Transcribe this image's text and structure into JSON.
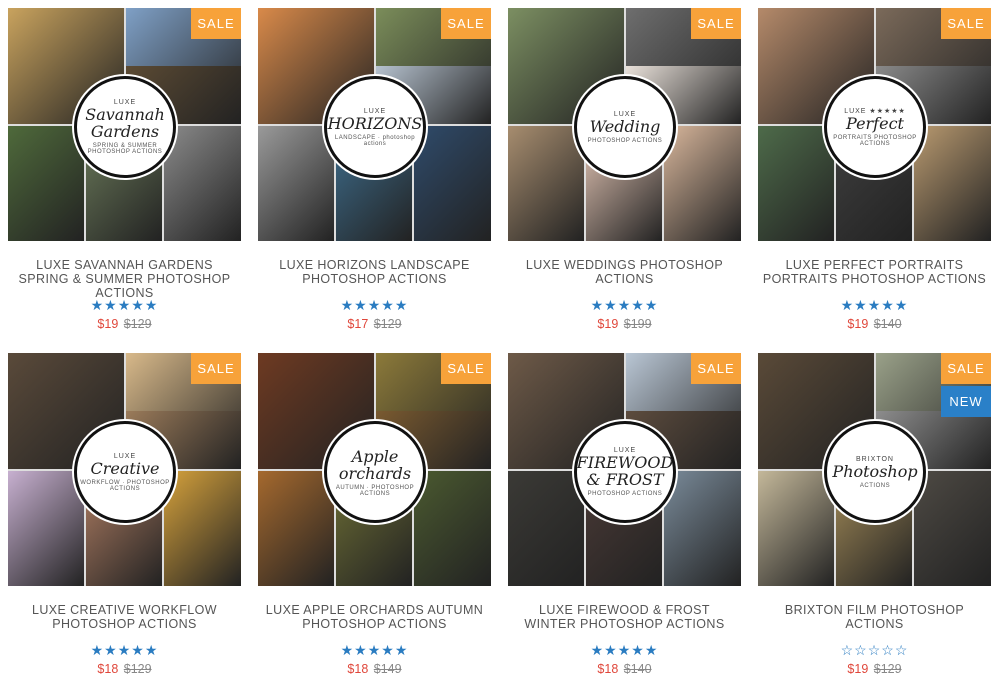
{
  "colors": {
    "sale_badge": "#f7a23a",
    "new_badge": "#2a80c8",
    "star": "#2a7cc1",
    "price_now": "#e0473b",
    "price_was": "#888888"
  },
  "products": [
    {
      "title": "LUXE SAVANNAH GARDENS SPRING & SUMMER PHOTOSHOP ACTIONS",
      "rating": 5,
      "price_now": "$19",
      "price_was": "$129",
      "badges": [
        "SALE"
      ],
      "logo": {
        "top": "LUXE",
        "main": "Savannah Gardens",
        "sub": "SPRING & SUMMER PHOTOSHOP ACTIONS"
      },
      "tiles": [
        "#c9a35e",
        "#7fa0c6",
        "#4f6a3b",
        "#6b7a5a",
        "#8b8b8b",
        "#5c4b34"
      ]
    },
    {
      "title": "LUXE HORIZONS LANDSCAPE PHOTOSHOP ACTIONS",
      "rating": 5,
      "price_now": "$17",
      "price_was": "$129",
      "badges": [
        "SALE"
      ],
      "logo": {
        "top": "LUXE",
        "main": "HORIZONS",
        "sub": "LANDSCAPE · photoshop actions"
      },
      "tiles": [
        "#d98a4a",
        "#7b8d5a",
        "#9a9a9a",
        "#3e6e8e",
        "#2f4b6b",
        "#b6c2cf"
      ]
    },
    {
      "title": "LUXE WEDDINGS PHOTOSHOP ACTIONS",
      "rating": 5,
      "price_now": "$19",
      "price_was": "$199",
      "badges": [
        "SALE"
      ],
      "logo": {
        "top": "LUXE",
        "main": "Wedding",
        "sub": "PHOTOSHOP ACTIONS"
      },
      "tiles": [
        "#7c8f62",
        "#6e6e6e",
        "#a78d6f",
        "#e8c9b8",
        "#d9b79c",
        "#e9e1da"
      ]
    },
    {
      "title": "LUXE PERFECT PORTRAITS PORTRAITS PHOTOSHOP ACTIONS",
      "rating": 5,
      "price_now": "$19",
      "price_was": "$140",
      "badges": [
        "SALE"
      ],
      "logo": {
        "top": "LUXE ★★★★★",
        "main": "Perfect",
        "sub": "PORTRAITS PHOTOSHOP ACTIONS"
      },
      "tiles": [
        "#b58a6a",
        "#7b6a5a",
        "#4e6b4a",
        "#3f3f3f",
        "#b99a70",
        "#8a8a8a"
      ]
    },
    {
      "title": "LUXE CREATIVE WORKFLOW PHOTOSHOP ACTIONS",
      "rating": 5,
      "price_now": "$18",
      "price_was": "$129",
      "badges": [
        "SALE"
      ],
      "logo": {
        "top": "LUXE",
        "main": "Creative",
        "sub": "WORKFLOW · PHOTOSHOP ACTIONS"
      },
      "tiles": [
        "#5a4a3a",
        "#d8b98a",
        "#c7b0d0",
        "#b07e63",
        "#d6a23c",
        "#9b7b5a"
      ]
    },
    {
      "title": "LUXE APPLE ORCHARDS AUTUMN PHOTOSHOP ACTIONS",
      "rating": 5,
      "price_now": "$18",
      "price_was": "$149",
      "badges": [
        "SALE"
      ],
      "logo": {
        "top": "",
        "main": "Apple orchards",
        "sub": "AUTUMN · PHOTOSHOP ACTIONS"
      },
      "tiles": [
        "#6e3a22",
        "#8c7a3a",
        "#a5692e",
        "#6d6e35",
        "#4b5a30",
        "#7a5a30"
      ]
    },
    {
      "title": "LUXE FIREWOOD & FROST WINTER PHOTOSHOP ACTIONS",
      "rating": 5,
      "price_now": "$18",
      "price_was": "$140",
      "badges": [
        "SALE"
      ],
      "logo": {
        "top": "LUXE",
        "main": "FIREWOOD & FROST",
        "sub": "PHOTOSHOP ACTIONS"
      },
      "tiles": [
        "#6e5a48",
        "#b9c6d4",
        "#3b3a36",
        "#4a3a36",
        "#7a8b9a",
        "#5d4c3e"
      ]
    },
    {
      "title": "BRIXTON FILM PHOTOSHOP ACTIONS",
      "rating": 0,
      "price_now": "$19",
      "price_was": "$129",
      "badges": [
        "SALE",
        "NEW"
      ],
      "logo": {
        "top": "BRIXTON",
        "main": "Photoshop",
        "sub": "ACTIONS"
      },
      "tiles": [
        "#5a4a38",
        "#9aa189",
        "#c4b89a",
        "#a38b58",
        "#4e4a44",
        "#8d8d8d"
      ]
    }
  ]
}
